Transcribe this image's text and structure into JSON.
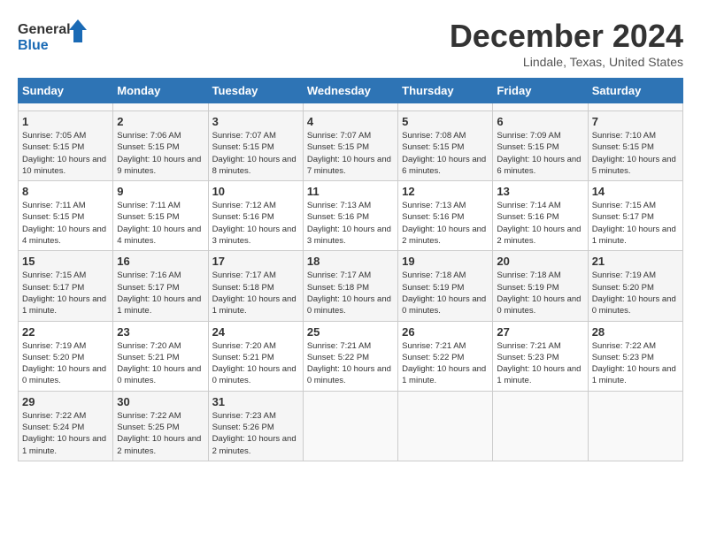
{
  "header": {
    "logo_text_general": "General",
    "logo_text_blue": "Blue",
    "month_title": "December 2024",
    "location": "Lindale, Texas, United States"
  },
  "calendar": {
    "days_of_week": [
      "Sunday",
      "Monday",
      "Tuesday",
      "Wednesday",
      "Thursday",
      "Friday",
      "Saturday"
    ],
    "weeks": [
      [
        {
          "day": "",
          "sunrise": "",
          "sunset": "",
          "daylight": ""
        },
        {
          "day": "",
          "sunrise": "",
          "sunset": "",
          "daylight": ""
        },
        {
          "day": "",
          "sunrise": "",
          "sunset": "",
          "daylight": ""
        },
        {
          "day": "",
          "sunrise": "",
          "sunset": "",
          "daylight": ""
        },
        {
          "day": "",
          "sunrise": "",
          "sunset": "",
          "daylight": ""
        },
        {
          "day": "",
          "sunrise": "",
          "sunset": "",
          "daylight": ""
        },
        {
          "day": "",
          "sunrise": "",
          "sunset": "",
          "daylight": ""
        }
      ],
      [
        {
          "day": "1",
          "sunrise": "Sunrise: 7:05 AM",
          "sunset": "Sunset: 5:15 PM",
          "daylight": "Daylight: 10 hours and 10 minutes."
        },
        {
          "day": "2",
          "sunrise": "Sunrise: 7:06 AM",
          "sunset": "Sunset: 5:15 PM",
          "daylight": "Daylight: 10 hours and 9 minutes."
        },
        {
          "day": "3",
          "sunrise": "Sunrise: 7:07 AM",
          "sunset": "Sunset: 5:15 PM",
          "daylight": "Daylight: 10 hours and 8 minutes."
        },
        {
          "day": "4",
          "sunrise": "Sunrise: 7:07 AM",
          "sunset": "Sunset: 5:15 PM",
          "daylight": "Daylight: 10 hours and 7 minutes."
        },
        {
          "day": "5",
          "sunrise": "Sunrise: 7:08 AM",
          "sunset": "Sunset: 5:15 PM",
          "daylight": "Daylight: 10 hours and 6 minutes."
        },
        {
          "day": "6",
          "sunrise": "Sunrise: 7:09 AM",
          "sunset": "Sunset: 5:15 PM",
          "daylight": "Daylight: 10 hours and 6 minutes."
        },
        {
          "day": "7",
          "sunrise": "Sunrise: 7:10 AM",
          "sunset": "Sunset: 5:15 PM",
          "daylight": "Daylight: 10 hours and 5 minutes."
        }
      ],
      [
        {
          "day": "8",
          "sunrise": "Sunrise: 7:11 AM",
          "sunset": "Sunset: 5:15 PM",
          "daylight": "Daylight: 10 hours and 4 minutes."
        },
        {
          "day": "9",
          "sunrise": "Sunrise: 7:11 AM",
          "sunset": "Sunset: 5:15 PM",
          "daylight": "Daylight: 10 hours and 4 minutes."
        },
        {
          "day": "10",
          "sunrise": "Sunrise: 7:12 AM",
          "sunset": "Sunset: 5:16 PM",
          "daylight": "Daylight: 10 hours and 3 minutes."
        },
        {
          "day": "11",
          "sunrise": "Sunrise: 7:13 AM",
          "sunset": "Sunset: 5:16 PM",
          "daylight": "Daylight: 10 hours and 3 minutes."
        },
        {
          "day": "12",
          "sunrise": "Sunrise: 7:13 AM",
          "sunset": "Sunset: 5:16 PM",
          "daylight": "Daylight: 10 hours and 2 minutes."
        },
        {
          "day": "13",
          "sunrise": "Sunrise: 7:14 AM",
          "sunset": "Sunset: 5:16 PM",
          "daylight": "Daylight: 10 hours and 2 minutes."
        },
        {
          "day": "14",
          "sunrise": "Sunrise: 7:15 AM",
          "sunset": "Sunset: 5:17 PM",
          "daylight": "Daylight: 10 hours and 1 minute."
        }
      ],
      [
        {
          "day": "15",
          "sunrise": "Sunrise: 7:15 AM",
          "sunset": "Sunset: 5:17 PM",
          "daylight": "Daylight: 10 hours and 1 minute."
        },
        {
          "day": "16",
          "sunrise": "Sunrise: 7:16 AM",
          "sunset": "Sunset: 5:17 PM",
          "daylight": "Daylight: 10 hours and 1 minute."
        },
        {
          "day": "17",
          "sunrise": "Sunrise: 7:17 AM",
          "sunset": "Sunset: 5:18 PM",
          "daylight": "Daylight: 10 hours and 1 minute."
        },
        {
          "day": "18",
          "sunrise": "Sunrise: 7:17 AM",
          "sunset": "Sunset: 5:18 PM",
          "daylight": "Daylight: 10 hours and 0 minutes."
        },
        {
          "day": "19",
          "sunrise": "Sunrise: 7:18 AM",
          "sunset": "Sunset: 5:19 PM",
          "daylight": "Daylight: 10 hours and 0 minutes."
        },
        {
          "day": "20",
          "sunrise": "Sunrise: 7:18 AM",
          "sunset": "Sunset: 5:19 PM",
          "daylight": "Daylight: 10 hours and 0 minutes."
        },
        {
          "day": "21",
          "sunrise": "Sunrise: 7:19 AM",
          "sunset": "Sunset: 5:20 PM",
          "daylight": "Daylight: 10 hours and 0 minutes."
        }
      ],
      [
        {
          "day": "22",
          "sunrise": "Sunrise: 7:19 AM",
          "sunset": "Sunset: 5:20 PM",
          "daylight": "Daylight: 10 hours and 0 minutes."
        },
        {
          "day": "23",
          "sunrise": "Sunrise: 7:20 AM",
          "sunset": "Sunset: 5:21 PM",
          "daylight": "Daylight: 10 hours and 0 minutes."
        },
        {
          "day": "24",
          "sunrise": "Sunrise: 7:20 AM",
          "sunset": "Sunset: 5:21 PM",
          "daylight": "Daylight: 10 hours and 0 minutes."
        },
        {
          "day": "25",
          "sunrise": "Sunrise: 7:21 AM",
          "sunset": "Sunset: 5:22 PM",
          "daylight": "Daylight: 10 hours and 0 minutes."
        },
        {
          "day": "26",
          "sunrise": "Sunrise: 7:21 AM",
          "sunset": "Sunset: 5:22 PM",
          "daylight": "Daylight: 10 hours and 1 minute."
        },
        {
          "day": "27",
          "sunrise": "Sunrise: 7:21 AM",
          "sunset": "Sunset: 5:23 PM",
          "daylight": "Daylight: 10 hours and 1 minute."
        },
        {
          "day": "28",
          "sunrise": "Sunrise: 7:22 AM",
          "sunset": "Sunset: 5:23 PM",
          "daylight": "Daylight: 10 hours and 1 minute."
        }
      ],
      [
        {
          "day": "29",
          "sunrise": "Sunrise: 7:22 AM",
          "sunset": "Sunset: 5:24 PM",
          "daylight": "Daylight: 10 hours and 1 minute."
        },
        {
          "day": "30",
          "sunrise": "Sunrise: 7:22 AM",
          "sunset": "Sunset: 5:25 PM",
          "daylight": "Daylight: 10 hours and 2 minutes."
        },
        {
          "day": "31",
          "sunrise": "Sunrise: 7:23 AM",
          "sunset": "Sunset: 5:26 PM",
          "daylight": "Daylight: 10 hours and 2 minutes."
        },
        {
          "day": "",
          "sunrise": "",
          "sunset": "",
          "daylight": ""
        },
        {
          "day": "",
          "sunrise": "",
          "sunset": "",
          "daylight": ""
        },
        {
          "day": "",
          "sunrise": "",
          "sunset": "",
          "daylight": ""
        },
        {
          "day": "",
          "sunrise": "",
          "sunset": "",
          "daylight": ""
        }
      ]
    ]
  }
}
